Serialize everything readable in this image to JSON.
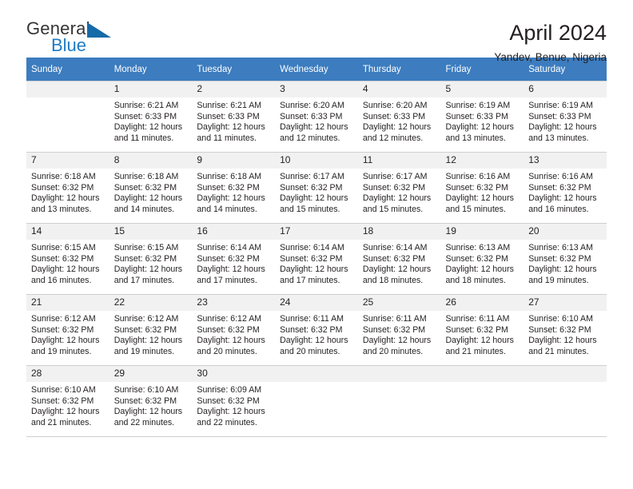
{
  "brand": {
    "name_part1": "General",
    "name_part2": "Blue",
    "triangle_color": "#156aa8",
    "blue_color": "#1e7bc4"
  },
  "header": {
    "title": "April 2024",
    "subtitle": "Yandev, Benue, Nigeria"
  },
  "theme": {
    "header_row_bg": "#3c7cbf",
    "daynum_bg": "#f1f1f1",
    "grid_line": "#cfcfcf",
    "text": "#231f20"
  },
  "weekdays": [
    "Sunday",
    "Monday",
    "Tuesday",
    "Wednesday",
    "Thursday",
    "Friday",
    "Saturday"
  ],
  "labels": {
    "sunrise_prefix": "Sunrise:",
    "sunset_prefix": "Sunset:",
    "daylight_prefix": "Daylight:"
  },
  "weeks": [
    [
      {
        "day": "",
        "sunrise": "",
        "sunset": "",
        "daylight_l1": "",
        "daylight_l2": ""
      },
      {
        "day": "1",
        "sunrise": "Sunrise: 6:21 AM",
        "sunset": "Sunset: 6:33 PM",
        "daylight_l1": "Daylight: 12 hours",
        "daylight_l2": "and 11 minutes."
      },
      {
        "day": "2",
        "sunrise": "Sunrise: 6:21 AM",
        "sunset": "Sunset: 6:33 PM",
        "daylight_l1": "Daylight: 12 hours",
        "daylight_l2": "and 11 minutes."
      },
      {
        "day": "3",
        "sunrise": "Sunrise: 6:20 AM",
        "sunset": "Sunset: 6:33 PM",
        "daylight_l1": "Daylight: 12 hours",
        "daylight_l2": "and 12 minutes."
      },
      {
        "day": "4",
        "sunrise": "Sunrise: 6:20 AM",
        "sunset": "Sunset: 6:33 PM",
        "daylight_l1": "Daylight: 12 hours",
        "daylight_l2": "and 12 minutes."
      },
      {
        "day": "5",
        "sunrise": "Sunrise: 6:19 AM",
        "sunset": "Sunset: 6:33 PM",
        "daylight_l1": "Daylight: 12 hours",
        "daylight_l2": "and 13 minutes."
      },
      {
        "day": "6",
        "sunrise": "Sunrise: 6:19 AM",
        "sunset": "Sunset: 6:33 PM",
        "daylight_l1": "Daylight: 12 hours",
        "daylight_l2": "and 13 minutes."
      }
    ],
    [
      {
        "day": "7",
        "sunrise": "Sunrise: 6:18 AM",
        "sunset": "Sunset: 6:32 PM",
        "daylight_l1": "Daylight: 12 hours",
        "daylight_l2": "and 13 minutes."
      },
      {
        "day": "8",
        "sunrise": "Sunrise: 6:18 AM",
        "sunset": "Sunset: 6:32 PM",
        "daylight_l1": "Daylight: 12 hours",
        "daylight_l2": "and 14 minutes."
      },
      {
        "day": "9",
        "sunrise": "Sunrise: 6:18 AM",
        "sunset": "Sunset: 6:32 PM",
        "daylight_l1": "Daylight: 12 hours",
        "daylight_l2": "and 14 minutes."
      },
      {
        "day": "10",
        "sunrise": "Sunrise: 6:17 AM",
        "sunset": "Sunset: 6:32 PM",
        "daylight_l1": "Daylight: 12 hours",
        "daylight_l2": "and 15 minutes."
      },
      {
        "day": "11",
        "sunrise": "Sunrise: 6:17 AM",
        "sunset": "Sunset: 6:32 PM",
        "daylight_l1": "Daylight: 12 hours",
        "daylight_l2": "and 15 minutes."
      },
      {
        "day": "12",
        "sunrise": "Sunrise: 6:16 AM",
        "sunset": "Sunset: 6:32 PM",
        "daylight_l1": "Daylight: 12 hours",
        "daylight_l2": "and 15 minutes."
      },
      {
        "day": "13",
        "sunrise": "Sunrise: 6:16 AM",
        "sunset": "Sunset: 6:32 PM",
        "daylight_l1": "Daylight: 12 hours",
        "daylight_l2": "and 16 minutes."
      }
    ],
    [
      {
        "day": "14",
        "sunrise": "Sunrise: 6:15 AM",
        "sunset": "Sunset: 6:32 PM",
        "daylight_l1": "Daylight: 12 hours",
        "daylight_l2": "and 16 minutes."
      },
      {
        "day": "15",
        "sunrise": "Sunrise: 6:15 AM",
        "sunset": "Sunset: 6:32 PM",
        "daylight_l1": "Daylight: 12 hours",
        "daylight_l2": "and 17 minutes."
      },
      {
        "day": "16",
        "sunrise": "Sunrise: 6:14 AM",
        "sunset": "Sunset: 6:32 PM",
        "daylight_l1": "Daylight: 12 hours",
        "daylight_l2": "and 17 minutes."
      },
      {
        "day": "17",
        "sunrise": "Sunrise: 6:14 AM",
        "sunset": "Sunset: 6:32 PM",
        "daylight_l1": "Daylight: 12 hours",
        "daylight_l2": "and 17 minutes."
      },
      {
        "day": "18",
        "sunrise": "Sunrise: 6:14 AM",
        "sunset": "Sunset: 6:32 PM",
        "daylight_l1": "Daylight: 12 hours",
        "daylight_l2": "and 18 minutes."
      },
      {
        "day": "19",
        "sunrise": "Sunrise: 6:13 AM",
        "sunset": "Sunset: 6:32 PM",
        "daylight_l1": "Daylight: 12 hours",
        "daylight_l2": "and 18 minutes."
      },
      {
        "day": "20",
        "sunrise": "Sunrise: 6:13 AM",
        "sunset": "Sunset: 6:32 PM",
        "daylight_l1": "Daylight: 12 hours",
        "daylight_l2": "and 19 minutes."
      }
    ],
    [
      {
        "day": "21",
        "sunrise": "Sunrise: 6:12 AM",
        "sunset": "Sunset: 6:32 PM",
        "daylight_l1": "Daylight: 12 hours",
        "daylight_l2": "and 19 minutes."
      },
      {
        "day": "22",
        "sunrise": "Sunrise: 6:12 AM",
        "sunset": "Sunset: 6:32 PM",
        "daylight_l1": "Daylight: 12 hours",
        "daylight_l2": "and 19 minutes."
      },
      {
        "day": "23",
        "sunrise": "Sunrise: 6:12 AM",
        "sunset": "Sunset: 6:32 PM",
        "daylight_l1": "Daylight: 12 hours",
        "daylight_l2": "and 20 minutes."
      },
      {
        "day": "24",
        "sunrise": "Sunrise: 6:11 AM",
        "sunset": "Sunset: 6:32 PM",
        "daylight_l1": "Daylight: 12 hours",
        "daylight_l2": "and 20 minutes."
      },
      {
        "day": "25",
        "sunrise": "Sunrise: 6:11 AM",
        "sunset": "Sunset: 6:32 PM",
        "daylight_l1": "Daylight: 12 hours",
        "daylight_l2": "and 20 minutes."
      },
      {
        "day": "26",
        "sunrise": "Sunrise: 6:11 AM",
        "sunset": "Sunset: 6:32 PM",
        "daylight_l1": "Daylight: 12 hours",
        "daylight_l2": "and 21 minutes."
      },
      {
        "day": "27",
        "sunrise": "Sunrise: 6:10 AM",
        "sunset": "Sunset: 6:32 PM",
        "daylight_l1": "Daylight: 12 hours",
        "daylight_l2": "and 21 minutes."
      }
    ],
    [
      {
        "day": "28",
        "sunrise": "Sunrise: 6:10 AM",
        "sunset": "Sunset: 6:32 PM",
        "daylight_l1": "Daylight: 12 hours",
        "daylight_l2": "and 21 minutes."
      },
      {
        "day": "29",
        "sunrise": "Sunrise: 6:10 AM",
        "sunset": "Sunset: 6:32 PM",
        "daylight_l1": "Daylight: 12 hours",
        "daylight_l2": "and 22 minutes."
      },
      {
        "day": "30",
        "sunrise": "Sunrise: 6:09 AM",
        "sunset": "Sunset: 6:32 PM",
        "daylight_l1": "Daylight: 12 hours",
        "daylight_l2": "and 22 minutes."
      },
      {
        "day": "",
        "sunrise": "",
        "sunset": "",
        "daylight_l1": "",
        "daylight_l2": ""
      },
      {
        "day": "",
        "sunrise": "",
        "sunset": "",
        "daylight_l1": "",
        "daylight_l2": ""
      },
      {
        "day": "",
        "sunrise": "",
        "sunset": "",
        "daylight_l1": "",
        "daylight_l2": ""
      },
      {
        "day": "",
        "sunrise": "",
        "sunset": "",
        "daylight_l1": "",
        "daylight_l2": ""
      }
    ]
  ]
}
